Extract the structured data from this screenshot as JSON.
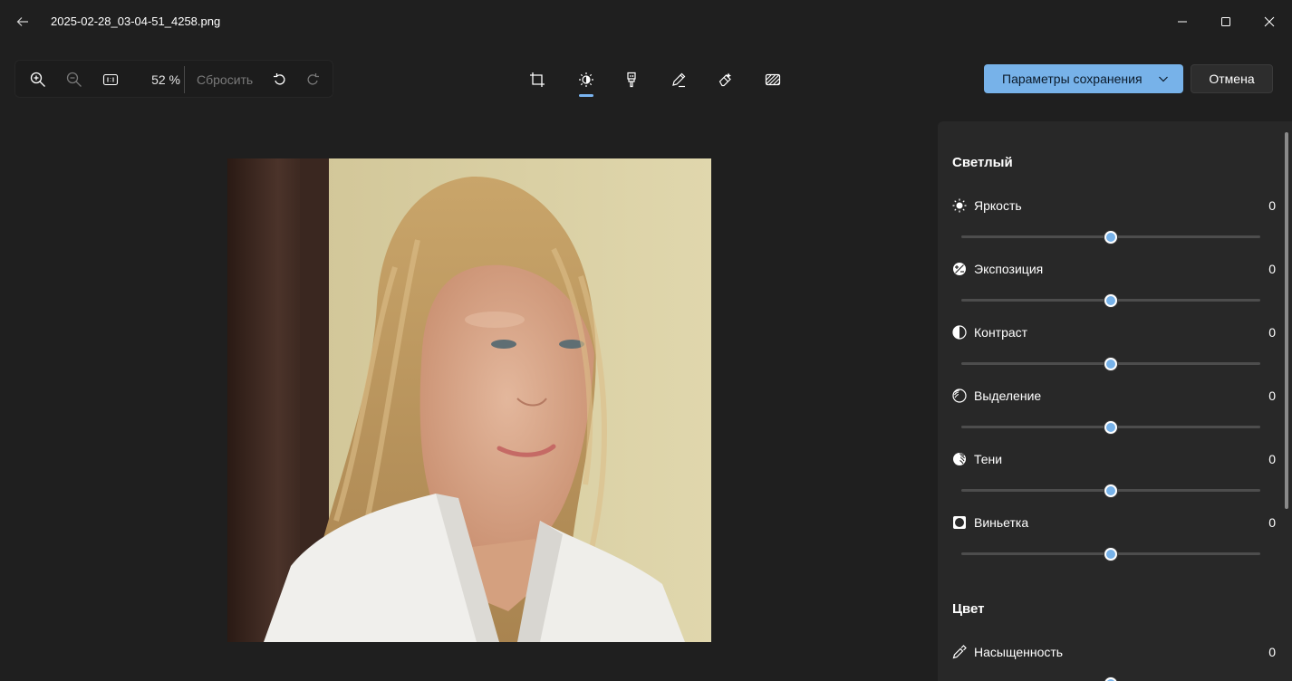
{
  "window": {
    "file_name": "2025-02-28_03-04-51_4258.png"
  },
  "toolbar": {
    "zoom_level": "52 %",
    "reset_label": "Сбросить"
  },
  "actions": {
    "save_label": "Параметры сохранения",
    "cancel_label": "Отмена"
  },
  "colors": {
    "accent": "#77b2e9",
    "background": "#1f1f1f",
    "panel": "#282828"
  },
  "panel": {
    "light_title": "Светлый",
    "color_title": "Цвет",
    "adjustments": [
      {
        "label": "Яркость",
        "value": "0",
        "icon": "brightness-icon",
        "level": 0.5
      },
      {
        "label": "Экспозиция",
        "value": "0",
        "icon": "exposure-icon",
        "level": 0.5
      },
      {
        "label": "Контраст",
        "value": "0",
        "icon": "contrast-icon",
        "level": 0.5
      },
      {
        "label": "Выделение",
        "value": "0",
        "icon": "highlights-icon",
        "level": 0.5
      },
      {
        "label": "Тени",
        "value": "0",
        "icon": "shadows-icon",
        "level": 0.5
      },
      {
        "label": "Виньетка",
        "value": "0",
        "icon": "vignette-icon",
        "level": 0.5
      }
    ],
    "color_adjustments": [
      {
        "label": "Насыщенность",
        "value": "0",
        "icon": "saturation-icon",
        "level": 0.5
      }
    ]
  }
}
